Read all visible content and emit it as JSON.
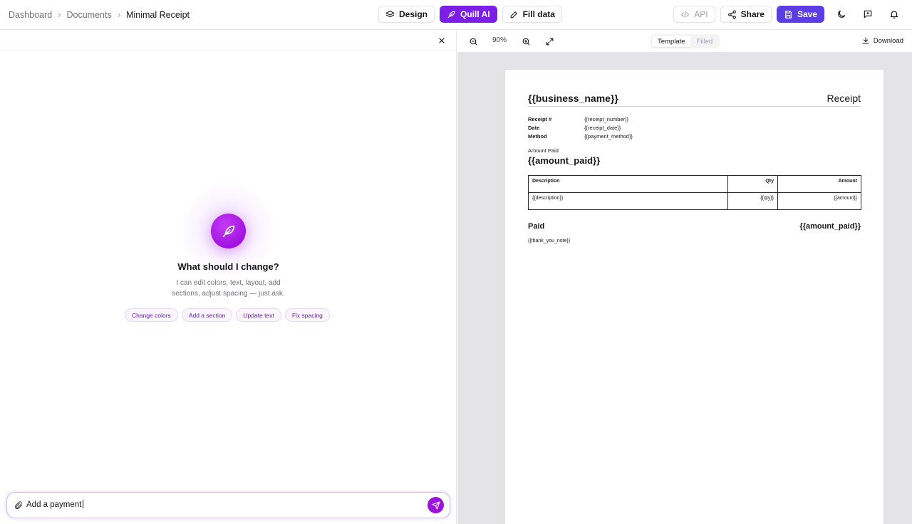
{
  "breadcrumb": {
    "items": [
      "Dashboard",
      "Documents"
    ],
    "current": "Minimal Receipt"
  },
  "toolbar": {
    "design_label": "Design",
    "quill_label": "Quill AI",
    "fill_label": "Fill data",
    "api_label": "API",
    "share_label": "Share",
    "save_label": "Save"
  },
  "colors": {
    "accent": "#7c1fe6",
    "save": "#5b3fe4",
    "send": "#9b13dc"
  },
  "ai_panel": {
    "title": "What should I change?",
    "subtitle": "I can edit colors, text, layout, add sections, adjust spacing — just ask.",
    "chips": [
      "Change colors",
      "Add a section",
      "Update text",
      "Fix spacing"
    ],
    "input_value": "Add a payment"
  },
  "preview": {
    "zoom": "90%",
    "modes": [
      "Template",
      "Filled"
    ],
    "active_mode": "Template",
    "download_label": "Download"
  },
  "document": {
    "business_name": "{{business_name}}",
    "doc_title": "Receipt",
    "meta": [
      {
        "key": "Receipt #",
        "value": "{{receipt_number}}"
      },
      {
        "key": "Date",
        "value": "{{receipt_date}}"
      },
      {
        "key": "Method",
        "value": "{{payment_method}}"
      }
    ],
    "amount_label": "Amount Paid",
    "amount_value": "{{amount_paid}}",
    "table": {
      "headers": [
        "Description",
        "Qty",
        "Amount"
      ],
      "row": [
        "{{description}}",
        "{{qty}}",
        "{{amount}}"
      ]
    },
    "paid_label": "Paid",
    "paid_value": "{{amount_paid}}",
    "thanks": "{{thank_you_note}}"
  }
}
